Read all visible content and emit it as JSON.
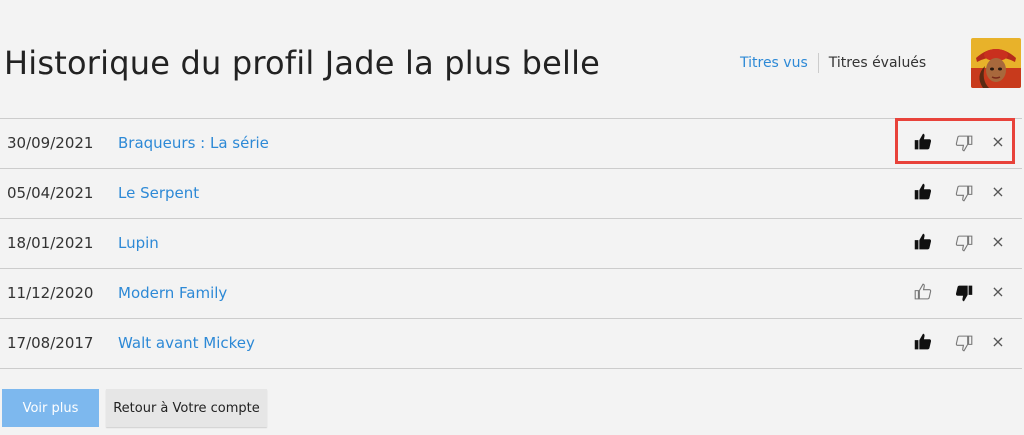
{
  "header": {
    "title": "Historique du profil Jade la plus belle",
    "tabs": {
      "viewed_label": "Titres vus",
      "rated_label": "Titres évalués"
    },
    "avatar_icon": "profile-avatar"
  },
  "history": [
    {
      "date": "30/09/2021",
      "title": "Braqueurs : La série",
      "rating": "up"
    },
    {
      "date": "05/04/2021",
      "title": "Le Serpent",
      "rating": "up"
    },
    {
      "date": "18/01/2021",
      "title": "Lupin",
      "rating": "up"
    },
    {
      "date": "11/12/2020",
      "title": "Modern Family",
      "rating": "down"
    },
    {
      "date": "17/08/2017",
      "title": "Walt avant Mickey",
      "rating": "up"
    }
  ],
  "icons": {
    "thumb_up": "thumbs-up-icon",
    "thumb_down": "thumbs-down-icon",
    "remove": "close-icon",
    "remove_glyph": "×"
  },
  "buttons": {
    "more_label": "Voir plus",
    "back_label": "Retour à Votre compte"
  },
  "colors": {
    "link": "#2d89d6",
    "highlight": "#e8423a",
    "primary_button": "#7db8ee"
  }
}
